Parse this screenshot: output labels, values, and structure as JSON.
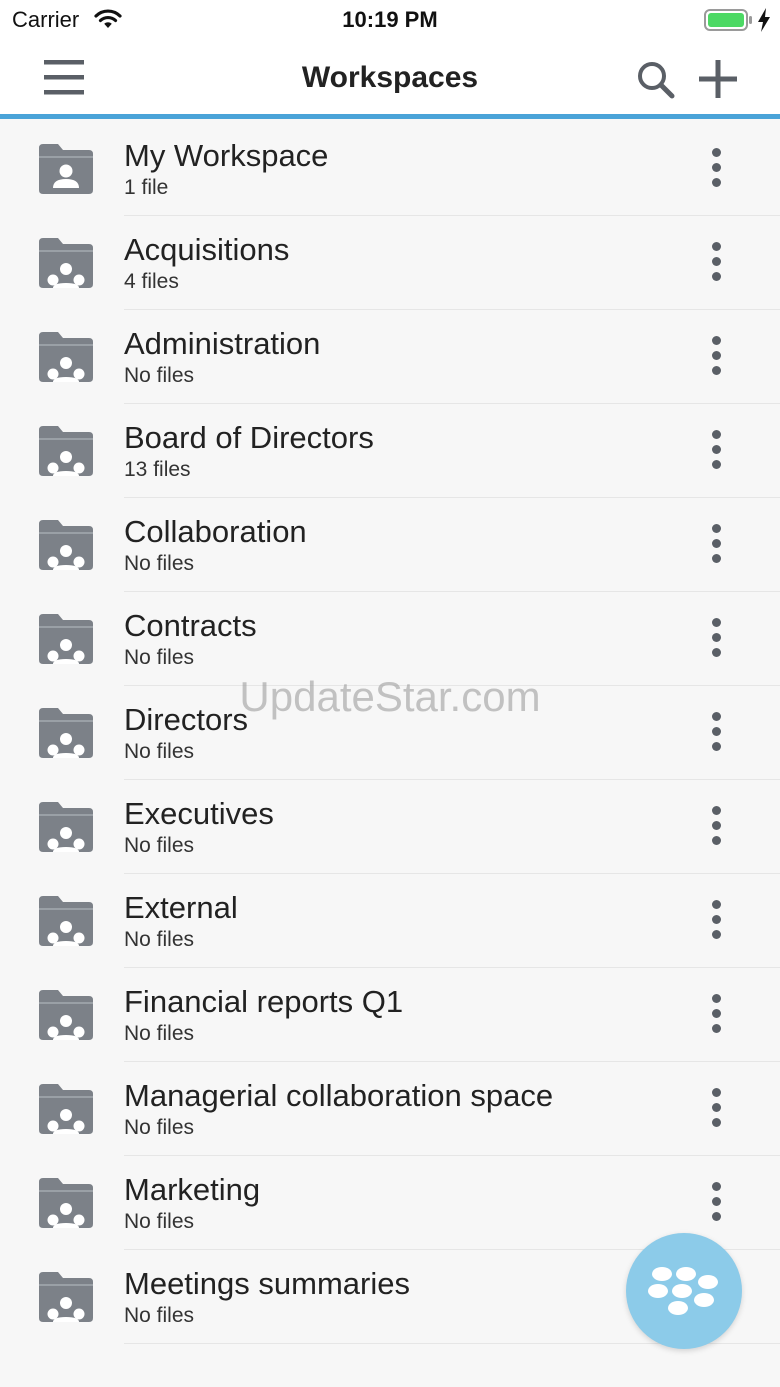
{
  "status": {
    "carrier": "Carrier",
    "time": "10:19 PM",
    "battery_color": "#4cd964"
  },
  "nav": {
    "title": "Workspaces",
    "accent": "#4aa3d8",
    "menu_icon": "hamburger-menu-icon",
    "search_icon": "search-icon",
    "add_icon": "plus-icon"
  },
  "workspaces": [
    {
      "name": "My Workspace",
      "files": "1 file",
      "icon": "personal-folder-icon"
    },
    {
      "name": "Acquisitions",
      "files": "4 files",
      "icon": "shared-folder-icon"
    },
    {
      "name": "Administration",
      "files": "No files",
      "icon": "shared-folder-icon"
    },
    {
      "name": "Board of Directors",
      "files": "13 files",
      "icon": "shared-folder-icon"
    },
    {
      "name": "Collaboration",
      "files": "No files",
      "icon": "shared-folder-icon"
    },
    {
      "name": "Contracts",
      "files": "No files",
      "icon": "shared-folder-icon"
    },
    {
      "name": "Directors",
      "files": "No files",
      "icon": "shared-folder-icon"
    },
    {
      "name": "Executives",
      "files": "No files",
      "icon": "shared-folder-icon"
    },
    {
      "name": "External",
      "files": "No files",
      "icon": "shared-folder-icon"
    },
    {
      "name": "Financial reports Q1",
      "files": "No files",
      "icon": "shared-folder-icon"
    },
    {
      "name": "Managerial collaboration space",
      "files": "No files",
      "icon": "shared-folder-icon"
    },
    {
      "name": "Marketing",
      "files": "No files",
      "icon": "shared-folder-icon"
    },
    {
      "name": "Meetings summaries",
      "files": "No files",
      "icon": "shared-folder-icon"
    }
  ],
  "watermark": "UpdateStar.com",
  "fab": {
    "icon": "blackberry-logo-icon",
    "color": "#8ccbe9"
  }
}
